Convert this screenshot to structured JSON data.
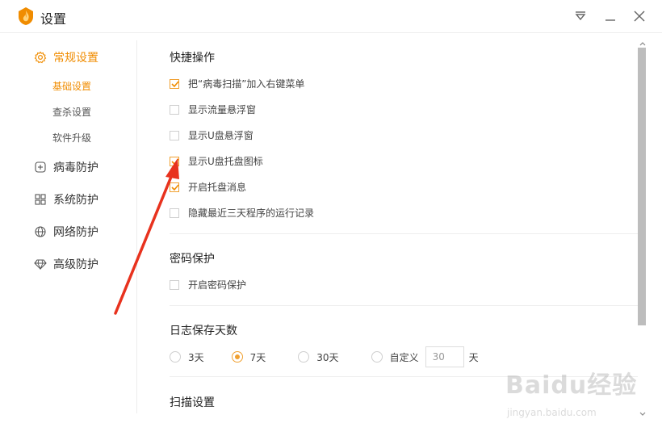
{
  "window": {
    "title": "设置"
  },
  "sidebar": {
    "items": [
      {
        "label": "常规设置",
        "icon": "gear-icon",
        "active": true,
        "sub": [
          {
            "label": "基础设置",
            "active": true
          },
          {
            "label": "查杀设置",
            "active": false
          },
          {
            "label": "软件升级",
            "active": false
          }
        ]
      },
      {
        "label": "病毒防护",
        "icon": "plus-square-icon"
      },
      {
        "label": "系统防护",
        "icon": "windows-icon"
      },
      {
        "label": "网络防护",
        "icon": "globe-icon"
      },
      {
        "label": "高级防护",
        "icon": "diamond-icon"
      }
    ]
  },
  "content": {
    "quick_actions": {
      "title": "快捷操作",
      "options": [
        {
          "label": "把“病毒扫描”加入右键菜单",
          "checked": true
        },
        {
          "label": "显示流量悬浮窗",
          "checked": false
        },
        {
          "label": "显示U盘悬浮窗",
          "checked": false
        },
        {
          "label": "显示U盘托盘图标",
          "checked": true
        },
        {
          "label": "开启托盘消息",
          "checked": true
        },
        {
          "label": "隐藏最近三天程序的运行记录",
          "checked": false
        }
      ]
    },
    "password": {
      "title": "密码保护",
      "options": [
        {
          "label": "开启密码保护",
          "checked": false
        }
      ]
    },
    "log_days": {
      "title": "日志保存天数",
      "options": [
        {
          "label": "3天",
          "selected": false
        },
        {
          "label": "7天",
          "selected": true
        },
        {
          "label": "30天",
          "selected": false
        },
        {
          "label": "自定义",
          "selected": false
        }
      ],
      "custom_value": "30",
      "unit": "天"
    },
    "scan": {
      "title": "扫描设置"
    }
  },
  "watermark": {
    "brand": "Baidu经验",
    "url": "jingyan.baidu.com"
  },
  "colors": {
    "accent": "#f08c00",
    "annotation_arrow": "#e8321e"
  }
}
